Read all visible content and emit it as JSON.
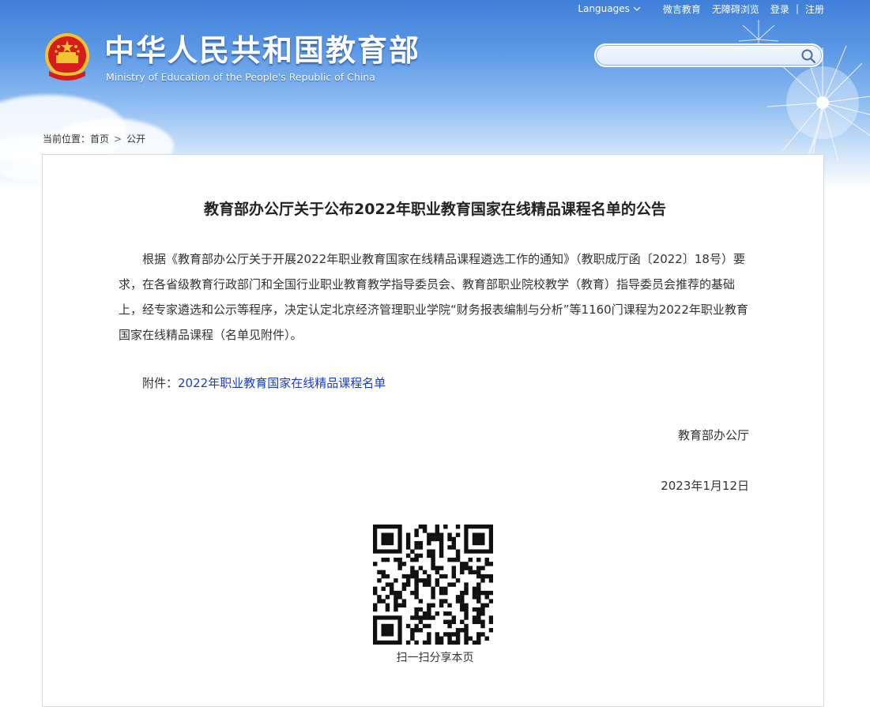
{
  "header": {
    "languages_label": "Languages",
    "top_links": [
      "微言教育",
      "无障碍浏览",
      "登录",
      "注册"
    ],
    "site_title": "中华人民共和国教育部",
    "site_subtitle": "Ministry of Education of the People's Republic of China",
    "search_placeholder": ""
  },
  "breadcrumb": {
    "prefix": "当前位置：",
    "items": [
      "首页",
      "公开"
    ]
  },
  "article": {
    "title": "教育部办公厅关于公布2022年职业教育国家在线精品课程名单的公告",
    "body": "根据《教育部办公厅关于开展2022年职业教育国家在线精品课程遴选工作的通知》（教职成厅函〔2022〕18号）要求，在各省级教育行政部门和全国行业职业教育教学指导委员会、教育部职业院校教学（教育）指导委员会推荐的基础上，经专家遴选和公示等程序，决定认定北京经济管理职业学院“财务报表编制与分析”等1160门课程为2022年职业教育国家在线精品课程（名单见附件）。",
    "attachment_label": "附件：",
    "attachment_link": "2022年职业教育国家在线精品课程名单",
    "issuer": "教育部办公厅",
    "date": "2023年1月12日"
  },
  "share": {
    "qr_caption": "扫一扫分享本页"
  },
  "colors": {
    "header_blue": "#3f7fd9",
    "link_blue": "#1a3cc8",
    "emblem_red": "#d51d1d",
    "emblem_gold": "#f4c430"
  },
  "icons": [
    "chevron-down-icon",
    "search-icon",
    "national-emblem",
    "qr-code"
  ]
}
